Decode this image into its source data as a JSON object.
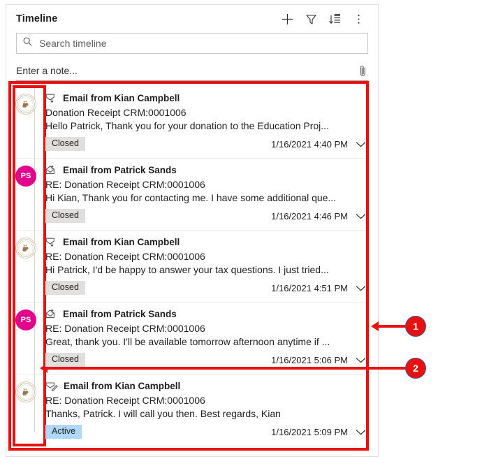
{
  "panel": {
    "title": "Timeline",
    "header_actions": [
      {
        "name": "add-record-button",
        "icon": "plus-icon",
        "label": "Add"
      },
      {
        "name": "filter-button",
        "icon": "funnel-icon",
        "label": "Filter"
      },
      {
        "name": "sort-button",
        "icon": "sort-descending-icon",
        "label": "Sort"
      },
      {
        "name": "more-commands-button",
        "icon": "more-vertical-icon",
        "label": "More commands"
      }
    ],
    "search": {
      "placeholder": "Search timeline",
      "value": "",
      "icon": "search-icon"
    },
    "note": {
      "placeholder": "Enter a note...",
      "value": "",
      "attach_icon": "paperclip-icon"
    }
  },
  "timeline": {
    "items": [
      {
        "avatar": {
          "type": "logo",
          "initials": "",
          "color": "#a4855e"
        },
        "mail_icon": "email-received-icon",
        "title": "Email from Kian Campbell",
        "subject": "Donation Receipt CRM:0001006",
        "snippet": "Hello Patrick,   Thank you for your donation to the Education Proj...",
        "status": "Closed",
        "status_kind": "closed",
        "timestamp": "1/16/2021 4:40 PM",
        "chevron": "chevron-down-icon"
      },
      {
        "avatar": {
          "type": "initials",
          "initials": "PS",
          "color": "#e3008c"
        },
        "mail_icon": "email-sent-icon",
        "title": "Email from Patrick Sands",
        "subject": "RE: Donation Receipt CRM:0001006",
        "snippet": "Hi Kian, Thank you for contacting me. I have some additional que...",
        "status": "Closed",
        "status_kind": "closed",
        "timestamp": "1/16/2021 4:46 PM",
        "chevron": "chevron-down-icon"
      },
      {
        "avatar": {
          "type": "logo",
          "initials": "",
          "color": "#a4855e"
        },
        "mail_icon": "email-received-icon",
        "title": "Email from Kian Campbell",
        "subject": "RE: Donation Receipt CRM:0001006",
        "snippet": "Hi Patrick,   I'd be happy to answer your tax questions. I just tried...",
        "status": "Closed",
        "status_kind": "closed",
        "timestamp": "1/16/2021 4:51 PM",
        "chevron": "chevron-down-icon"
      },
      {
        "avatar": {
          "type": "initials",
          "initials": "PS",
          "color": "#e3008c"
        },
        "mail_icon": "email-sent-icon",
        "title": "Email from Patrick Sands",
        "subject": "RE: Donation Receipt CRM:0001006",
        "snippet": "Great, thank you. I'll be available tomorrow afternoon anytime if ...",
        "status": "Closed",
        "status_kind": "closed",
        "timestamp": "1/16/2021 5:06 PM",
        "chevron": "chevron-down-icon"
      },
      {
        "avatar": {
          "type": "logo",
          "initials": "",
          "color": "#a4855e"
        },
        "mail_icon": "email-draft-icon",
        "title": "Email from Kian Campbell",
        "subject": "RE: Donation Receipt CRM:0001006",
        "snippet": "Thanks, Patrick. I will call you then.   Best regards, Kian",
        "status": "Active",
        "status_kind": "active",
        "timestamp": "1/16/2021 5:09 PM",
        "chevron": "chevron-down-icon"
      }
    ]
  },
  "annotations": {
    "color": "#e8110f",
    "callouts": [
      {
        "number": "1",
        "target": "timeline-records-outline"
      },
      {
        "number": "2",
        "target": "timeline-avatar-column-outline"
      }
    ]
  },
  "colors": {
    "annotation_red": "#e8110f",
    "avatar_pink": "#e3008c",
    "badge_closed": "#e1dfdd",
    "badge_active": "#aed7f8",
    "panel_border": "#e1dfdd"
  }
}
